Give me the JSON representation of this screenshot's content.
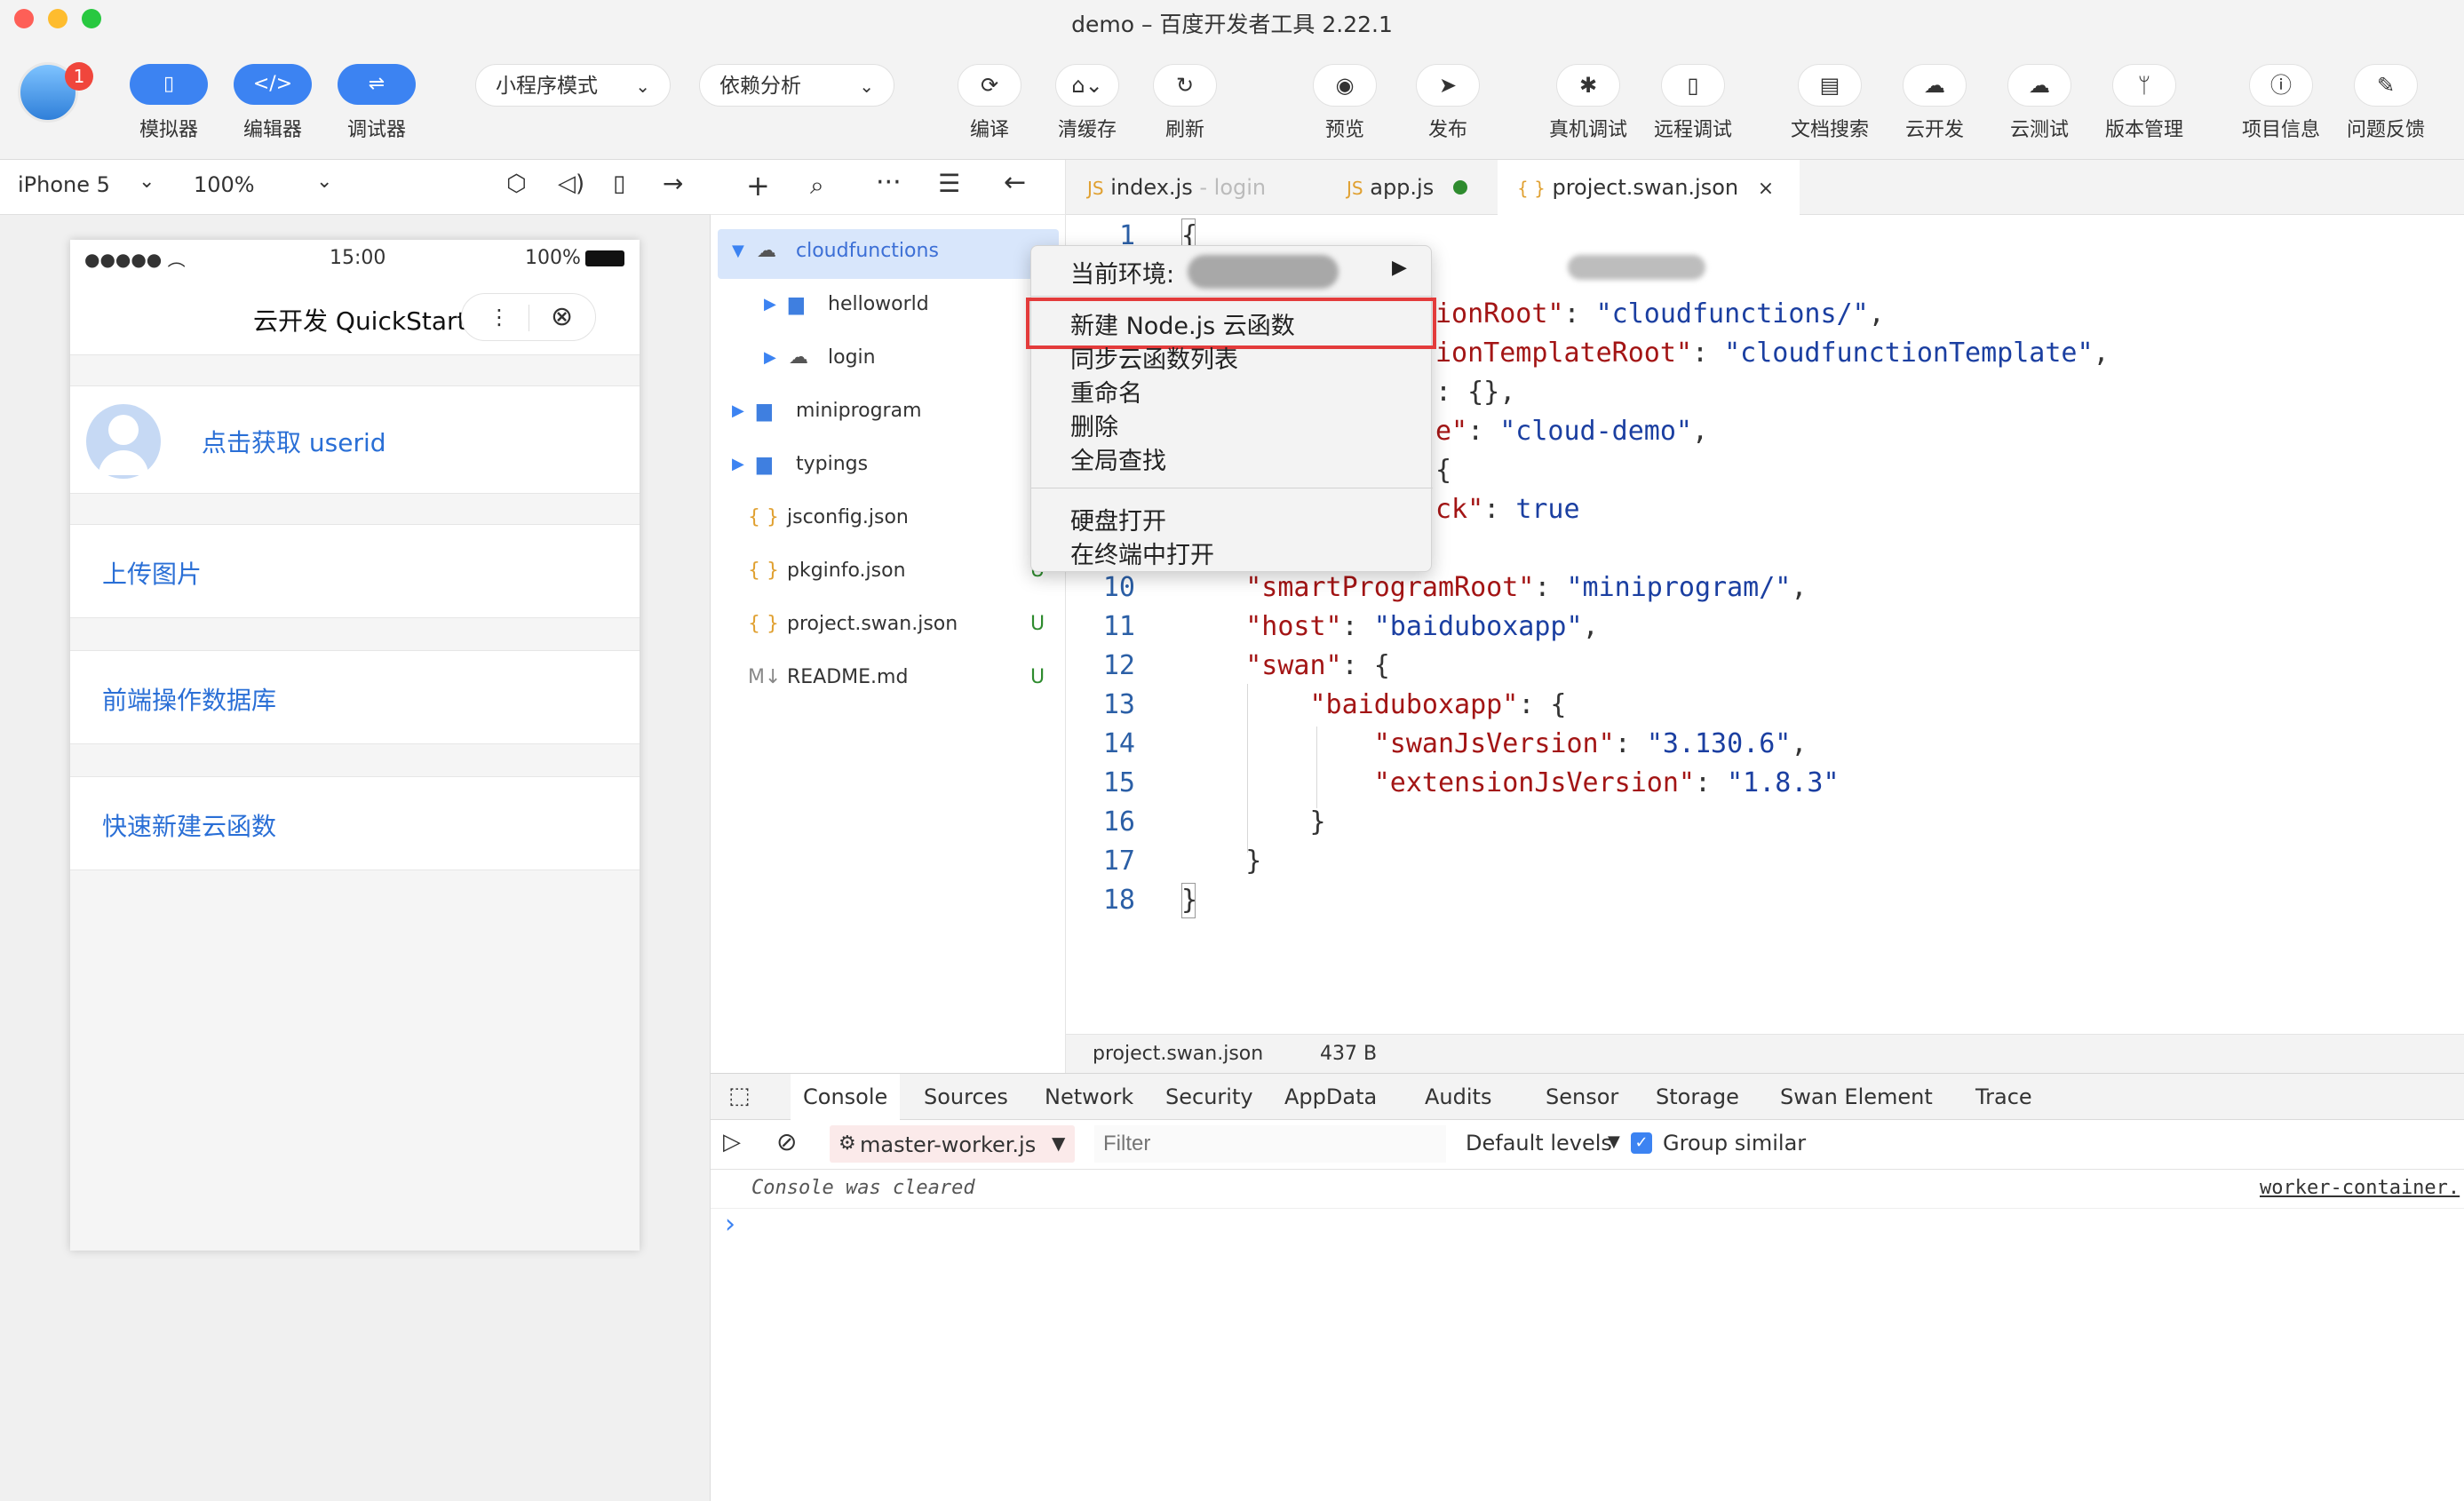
{
  "window": {
    "title": "demo – 百度开发者工具 2.22.1"
  },
  "user": {
    "badge": "1"
  },
  "modes": [
    {
      "label": "模拟器"
    },
    {
      "label": "编辑器"
    },
    {
      "label": "调试器"
    }
  ],
  "dropdowns": {
    "mode": "小程序模式",
    "analysis": "依赖分析"
  },
  "toolbar": [
    {
      "label": "编译",
      "icon": "refresh-icon"
    },
    {
      "label": "清缓存",
      "icon": "broom-icon"
    },
    {
      "label": "刷新",
      "icon": "reload-icon"
    },
    {
      "label": "预览",
      "icon": "eye-icon"
    },
    {
      "label": "发布",
      "icon": "paper-plane-icon"
    },
    {
      "label": "真机调试",
      "icon": "bug-icon"
    },
    {
      "label": "远程调试",
      "icon": "phone-icon"
    },
    {
      "label": "文档搜索",
      "icon": "document-icon"
    },
    {
      "label": "云开发",
      "icon": "cloud-icon"
    },
    {
      "label": "云测试",
      "icon": "cloud-test-icon"
    },
    {
      "label": "版本管理",
      "icon": "branch-icon"
    },
    {
      "label": "项目信息",
      "icon": "info-icon"
    },
    {
      "label": "问题反馈",
      "icon": "pen-icon"
    }
  ],
  "simulator": {
    "device": "iPhone 5",
    "zoom": "100%",
    "status": {
      "time": "15:00",
      "battery": "100%"
    },
    "nav_title": "云开发 QuickStart",
    "userid_link": "点击获取 userid",
    "items": [
      "上传图片",
      "前端操作数据库",
      "快速新建云函数"
    ]
  },
  "explorer": {
    "tree": [
      {
        "name": "cloudfunctions",
        "type": "cloud",
        "level": 0,
        "expanded": true,
        "status": ""
      },
      {
        "name": "helloworld",
        "type": "folder",
        "level": 1,
        "expanded": false,
        "status": ""
      },
      {
        "name": "login",
        "type": "cloud",
        "level": 1,
        "expanded": false,
        "status": ""
      },
      {
        "name": "miniprogram",
        "type": "folder",
        "level": 0,
        "expanded": false,
        "status": ""
      },
      {
        "name": "typings",
        "type": "folder",
        "level": 0,
        "expanded": false,
        "status": ""
      },
      {
        "name": "jsconfig.json",
        "type": "json",
        "level": 0,
        "status": ""
      },
      {
        "name": "pkginfo.json",
        "type": "json",
        "level": 0,
        "status": "U"
      },
      {
        "name": "project.swan.json",
        "type": "json",
        "level": 0,
        "status": "U"
      },
      {
        "name": "README.md",
        "type": "md",
        "level": 0,
        "status": "U"
      }
    ]
  },
  "tabs": [
    {
      "label": "index.js",
      "sub": "login",
      "badge": "JS"
    },
    {
      "label": "app.js",
      "badge": "JS",
      "modified": true
    },
    {
      "label": "project.swan.json",
      "badge": "{ }",
      "active": true
    }
  ],
  "editor": {
    "lines": [
      {
        "n": "1",
        "text": "{"
      },
      {
        "n": "",
        "text": ""
      },
      {
        "n": "",
        "text": "ionRoot\": \"cloudfunctions/\","
      },
      {
        "n": "",
        "text": "ionTemplateRoot\": \"cloudfunctionTemplate\","
      },
      {
        "n": "",
        "text": ": {},"
      },
      {
        "n": "",
        "text": "e\": \"cloud-demo\","
      },
      {
        "n": "",
        "text": "{"
      },
      {
        "n": "",
        "text": "ck\": true"
      },
      {
        "n": "",
        "text": ""
      },
      {
        "n": "10",
        "text": "    \"smartProgramRoot\": \"miniprogram/\","
      },
      {
        "n": "11",
        "text": "    \"host\": \"baiduboxapp\","
      },
      {
        "n": "12",
        "text": "    \"swan\": {"
      },
      {
        "n": "13",
        "text": "        \"baiduboxapp\": {"
      },
      {
        "n": "14",
        "text": "            \"swanJsVersion\": \"3.130.6\","
      },
      {
        "n": "15",
        "text": "            \"extensionJsVersion\": \"1.8.3\""
      },
      {
        "n": "16",
        "text": "        }"
      },
      {
        "n": "17",
        "text": "    }"
      },
      {
        "n": "18",
        "text": "}"
      }
    ]
  },
  "status_bar": {
    "file": "project.swan.json",
    "size": "437 B"
  },
  "context_menu": {
    "env_label": "当前环境:",
    "items": [
      "新建 Node.js 云函数",
      "同步云函数列表",
      "重命名",
      "删除",
      "全局查找"
    ],
    "items2": [
      "硬盘打开",
      "在终端中打开"
    ]
  },
  "devtools": {
    "tabs": [
      "Console",
      "Sources",
      "Network",
      "Security",
      "AppData",
      "Audits",
      "Sensor",
      "Storage",
      "Swan Element",
      "Trace"
    ],
    "context": "master-worker.js",
    "filter_placeholder": "Filter",
    "levels": "Default levels",
    "group_similar": "Group similar",
    "message": "Console was cleared",
    "source": "worker-container.",
    "prompt": "›"
  },
  "colors": {
    "accent": "#3c83f2",
    "highlight": "#e33b3b",
    "link": "#2a6fd6"
  }
}
